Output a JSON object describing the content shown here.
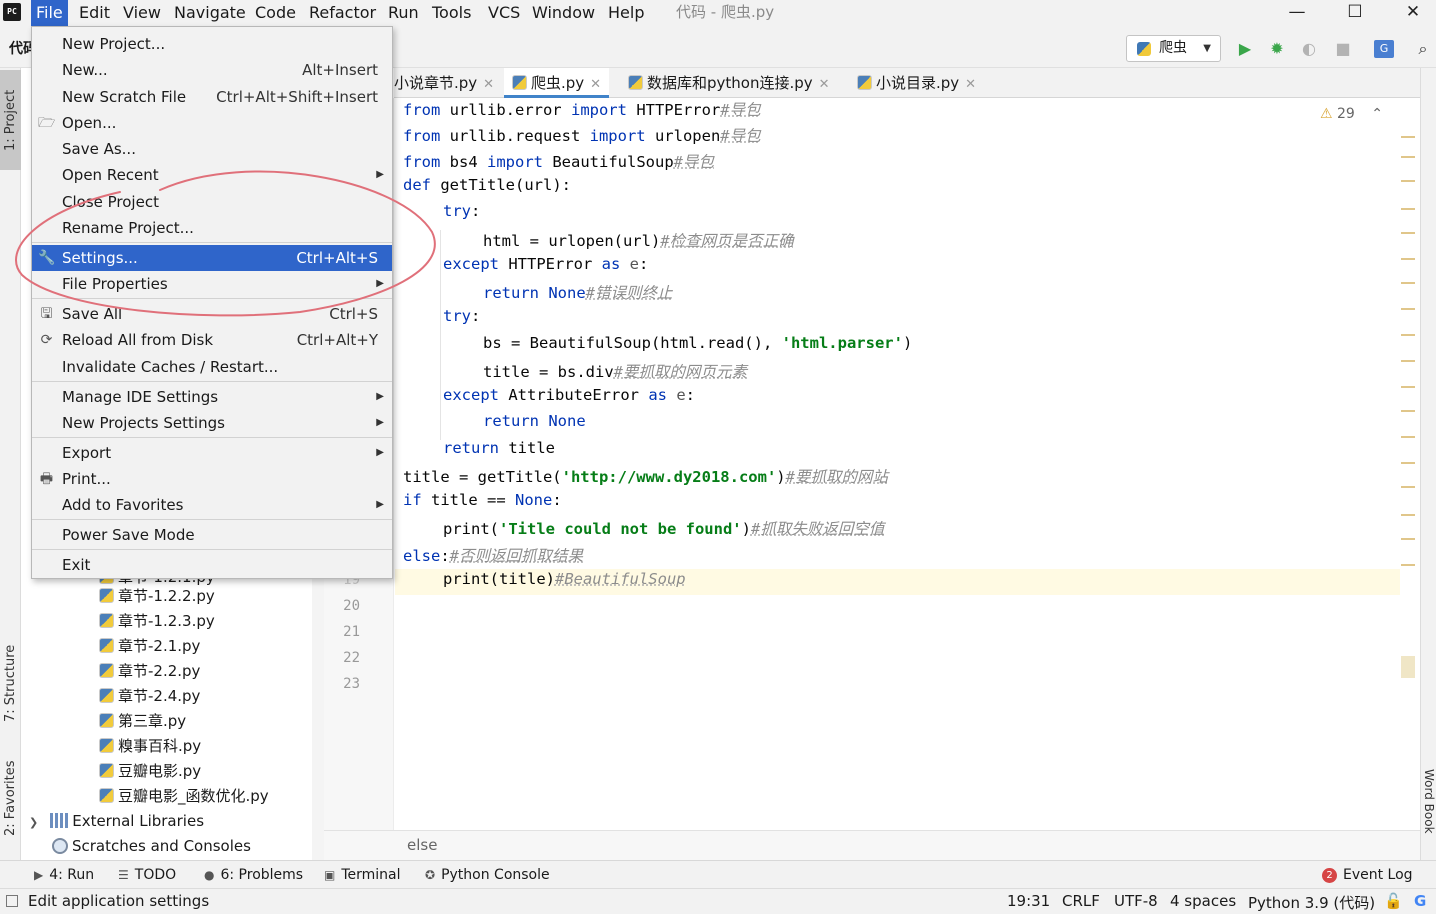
{
  "window": {
    "title": "代码 - 爬虫.py",
    "app_logo": "PC",
    "minimize": "—",
    "maximize": "☐",
    "close": "✕"
  },
  "menubar": [
    "File",
    "Edit",
    "View",
    "Navigate",
    "Code",
    "Refactor",
    "Run",
    "Tools",
    "VCS",
    "Window",
    "Help"
  ],
  "toolbar": {
    "project_crumb": "代码",
    "run_config": "爬虫",
    "icons": [
      "run-icon",
      "debug-icon",
      "coverage-icon",
      "stop-icon",
      "translate-icon",
      "search-icon"
    ]
  },
  "side_tabs": {
    "project": "1: Project",
    "structure": "7: Structure",
    "favorites": "2: Favorites",
    "word_book": "Word Book"
  },
  "file_menu": {
    "items": [
      {
        "label": "New Project...",
        "shortcut": "",
        "submenu": false,
        "icon": ""
      },
      {
        "label": "New...",
        "shortcut": "Alt+Insert",
        "submenu": false,
        "icon": ""
      },
      {
        "label": "New Scratch File",
        "shortcut": "Ctrl+Alt+Shift+Insert",
        "submenu": false,
        "icon": ""
      },
      {
        "label": "Open...",
        "shortcut": "",
        "submenu": false,
        "icon": "folder-icon"
      },
      {
        "label": "Save As...",
        "shortcut": "",
        "submenu": false,
        "icon": ""
      },
      {
        "label": "Open Recent",
        "shortcut": "",
        "submenu": true,
        "icon": ""
      },
      {
        "label": "Close Project",
        "shortcut": "",
        "submenu": false,
        "icon": ""
      },
      {
        "label": "Rename Project...",
        "shortcut": "",
        "submenu": false,
        "icon": ""
      },
      {
        "label": "Settings...",
        "shortcut": "Ctrl+Alt+S",
        "submenu": false,
        "icon": "wrench-icon",
        "selected": true
      },
      {
        "label": "File Properties",
        "shortcut": "",
        "submenu": true,
        "icon": ""
      },
      {
        "label": "Save All",
        "shortcut": "Ctrl+S",
        "submenu": false,
        "icon": "save-icon"
      },
      {
        "label": "Reload All from Disk",
        "shortcut": "Ctrl+Alt+Y",
        "submenu": false,
        "icon": "reload-icon"
      },
      {
        "label": "Invalidate Caches / Restart...",
        "shortcut": "",
        "submenu": false,
        "icon": ""
      },
      {
        "label": "Manage IDE Settings",
        "shortcut": "",
        "submenu": true,
        "icon": ""
      },
      {
        "label": "New Projects Settings",
        "shortcut": "",
        "submenu": true,
        "icon": ""
      },
      {
        "label": "Export",
        "shortcut": "",
        "submenu": true,
        "icon": ""
      },
      {
        "label": "Print...",
        "shortcut": "",
        "submenu": false,
        "icon": "print-icon"
      },
      {
        "label": "Add to Favorites",
        "shortcut": "",
        "submenu": true,
        "icon": ""
      },
      {
        "label": "Power Save Mode",
        "shortcut": "",
        "submenu": false,
        "icon": ""
      },
      {
        "label": "Exit",
        "shortcut": "",
        "submenu": false,
        "icon": ""
      }
    ]
  },
  "project_tree": {
    "partial_row": "章节-1.2.1.py",
    "files": [
      "章节-1.2.2.py",
      "章节-1.2.3.py",
      "章节-2.1.py",
      "章节-2.2.py",
      "章节-2.4.py",
      "第三章.py",
      "糗事百科.py",
      "豆瓣电影.py",
      "豆瓣电影_函数优化.py"
    ],
    "external_libraries": "External Libraries",
    "scratches": "Scratches and Consoles"
  },
  "editor_tabs": [
    {
      "label": "小说章节.py",
      "active": false
    },
    {
      "label": "爬虫.py",
      "active": true
    },
    {
      "label": "数据库和python连接.py",
      "active": false
    },
    {
      "label": "小说目录.py",
      "active": false
    }
  ],
  "inspection": {
    "warnings": "29"
  },
  "gutter_lines": [
    "19",
    "20",
    "21",
    "22",
    "23"
  ],
  "code": {
    "l1_a": "from",
    "l1_b": " urllib.error ",
    "l1_c": "import",
    "l1_d": " HTTPError",
    "l1_e": "#导包",
    "l2_a": "from",
    "l2_b": " urllib.request ",
    "l2_c": "import",
    "l2_d": " urlopen",
    "l2_e": "#导包",
    "l3_a": "from",
    "l3_b": " bs4 ",
    "l3_c": "import",
    "l3_d": " BeautifulSoup",
    "l3_e": "#导包",
    "l4_a": "def",
    "l4_b": " getTitle(url):",
    "l5_a": "try",
    "l5_b": ":",
    "l6_a": "html = urlopen(url)",
    "l6_b": "#检查网页是否正确",
    "l7_a": "except",
    "l7_b": " HTTPError ",
    "l7_c": "as",
    "l7_d": " e",
    "l7_e": ":",
    "l8_a": "return",
    "l8_b": " None",
    "l8_c": "#错误则终止",
    "l9_a": "try",
    "l9_b": ":",
    "l10_a": "bs = BeautifulSoup(html.read(), ",
    "l10_b": "'html.parser'",
    "l10_c": ")",
    "l11_a": "title = bs.div",
    "l11_b": "#要抓取的网页元素",
    "l12_a": "except",
    "l12_b": " AttributeError ",
    "l12_c": "as",
    "l12_d": " e",
    "l12_e": ":",
    "l13_a": "return",
    "l13_b": " None",
    "l14_a": "return",
    "l14_b": " title",
    "l15_a": "title = getTitle(",
    "l15_b": "'http://www.dy2018.com'",
    "l15_c": ")",
    "l15_d": "#要抓取的网站",
    "l16_a": "if",
    "l16_b": " title == ",
    "l16_c": "None",
    "l16_d": ":",
    "l17_a": "print(",
    "l17_b": "'Title could not be found'",
    "l17_c": ")",
    "l17_d": "#抓取失败返回空值",
    "l18_a": "else",
    "l18_b": ":",
    "l18_c": "#否则返回抓取结果",
    "l19_a": "print(title)",
    "l19_b": "#BeautifulSoup"
  },
  "breadcrumb": "else",
  "tool_windows": [
    {
      "label": "4: Run",
      "icon": "run-icon"
    },
    {
      "label": "TODO",
      "icon": "todo-icon"
    },
    {
      "label": "6: Problems",
      "icon": "problems-icon"
    },
    {
      "label": "Terminal",
      "icon": "terminal-icon"
    },
    {
      "label": "Python Console",
      "icon": "python-icon"
    }
  ],
  "event_log": {
    "label": "Event Log",
    "count": "2"
  },
  "status": {
    "message": "Edit application settings",
    "position": "19:31",
    "line_sep": "CRLF",
    "encoding": "UTF-8",
    "indent": "4 spaces",
    "interpreter": "Python 3.9 (代码)"
  },
  "colors": {
    "accent": "#2f65ca",
    "keyword": "#0033b3",
    "string": "#067d17",
    "comment": "#8c8c8c",
    "annotation_ink": "#e0707a"
  }
}
